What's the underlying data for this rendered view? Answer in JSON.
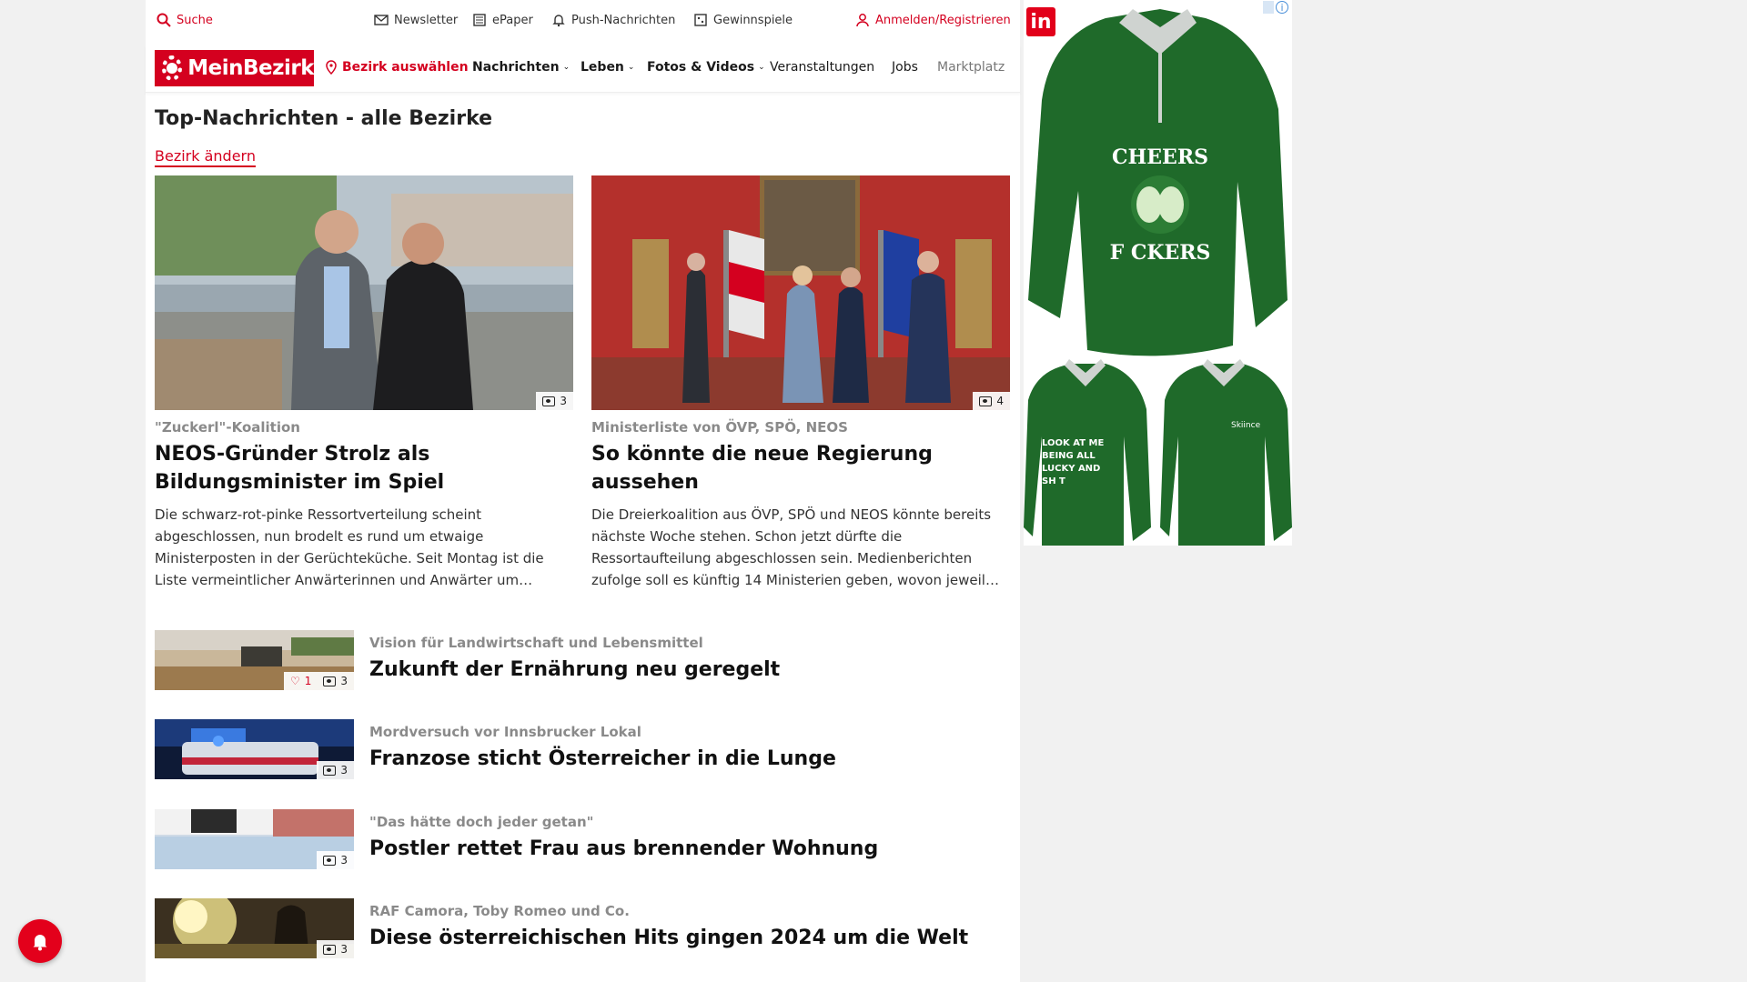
{
  "topbar": {
    "search": "Suche",
    "newsletter": "Newsletter",
    "epaper": "ePaper",
    "push": "Push-Nachrichten",
    "gewinnspiele": "Gewinnspiele",
    "login": "Anmelden/Registrieren"
  },
  "nav": {
    "logo": "MeinBezirk",
    "bezirk": "Bezirk auswählen",
    "items": [
      {
        "label": "Nachrichten",
        "dropdown": true
      },
      {
        "label": "Leben",
        "dropdown": true
      },
      {
        "label": "Fotos & Videos",
        "dropdown": true
      },
      {
        "label": "Veranstaltungen",
        "dropdown": false
      },
      {
        "label": "Jobs",
        "dropdown": false
      },
      {
        "label": "Marktplatz",
        "dropdown": false
      }
    ]
  },
  "main": {
    "title": "Top-Nachrichten - alle Bezirke",
    "change_link": "Bezirk ändern",
    "featured": [
      {
        "kicker": "\"Zuckerl\"-Koalition",
        "headline": "NEOS-Gründer Strolz als Bildungsminister im Spiel",
        "teaser": "Die schwarz-rot-pinke Ressortverteilung scheint abgeschlossen, nun brodelt es rund um etwaige Ministerposten in der Gerüchteküche. Seit Montag ist die Liste vermeintlicher Anwärterinnen und Anwärter um…",
        "images": "3"
      },
      {
        "kicker": "Ministerliste von ÖVP, SPÖ, NEOS",
        "headline": "So könnte die neue Regierung aussehen",
        "teaser": "Die Dreierkoalition aus ÖVP, SPÖ und NEOS könnte bereits nächste Woche stehen. Schon jetzt dürfte die Ressortaufteilung abgeschlossen sein. Medienberichten zufolge soll es künftig 14 Ministerien geben, wovon jeweil…",
        "images": "4"
      }
    ],
    "list": [
      {
        "kicker": "Vision für Landwirtschaft und Lebensmittel",
        "headline": "Zukunft der Ernährung neu geregelt",
        "likes": "1",
        "images": "3"
      },
      {
        "kicker": "Mordversuch vor Innsbrucker Lokal",
        "headline": "Franzose sticht Österreicher in die Lunge",
        "images": "3"
      },
      {
        "kicker": "\"Das hätte doch jeder getan\"",
        "headline": "Postler rettet Frau aus brennender Wohnung",
        "images": "3"
      },
      {
        "kicker": "RAF Camora, Toby Romeo und Co.",
        "headline": "Diese österreichischen Hits gingen 2024 um die Welt",
        "images": "3"
      }
    ]
  },
  "ad": {
    "brand": "in",
    "shirt_text_top": "CHEERS",
    "shirt_text_bottom": "F CKERS",
    "small_left_text": "LOOK AT ME BEING ALL LUCKY AND SH T",
    "small_right_text": "Skiince"
  },
  "colors": {
    "brand": "#d4001f",
    "kicker": "#8a8a8a"
  }
}
